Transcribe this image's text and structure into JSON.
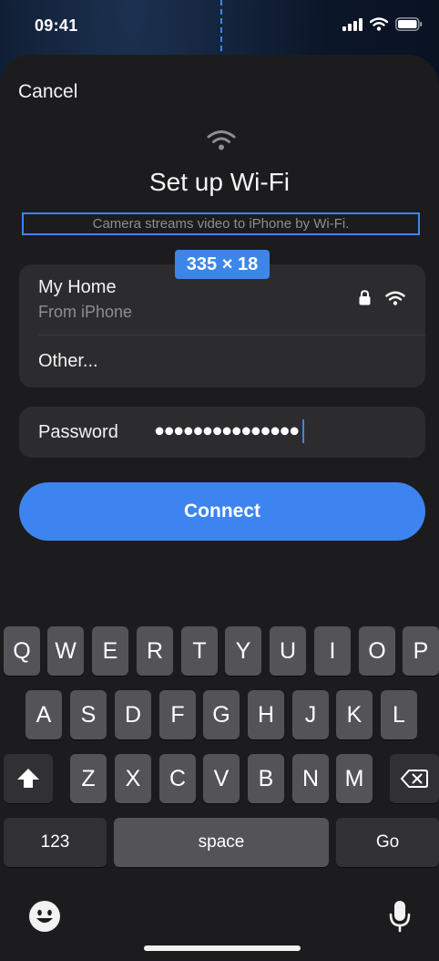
{
  "status_bar": {
    "time": "09:41"
  },
  "header": {
    "cancel_label": "Cancel",
    "title": "Set up Wi-Fi",
    "subtitle": "Camera streams video to iPhone by Wi-Fi.",
    "measure_badge": "335 × 18"
  },
  "network": {
    "name": "My Home",
    "source": "From iPhone",
    "other_label": "Other..."
  },
  "password": {
    "label": "Password",
    "masked_value": "●●●●●●●●●●●●●●●"
  },
  "connect_label": "Connect",
  "keyboard": {
    "row1": [
      "Q",
      "W",
      "E",
      "R",
      "T",
      "Y",
      "U",
      "I",
      "O",
      "P"
    ],
    "row2": [
      "A",
      "S",
      "D",
      "F",
      "G",
      "H",
      "J",
      "K",
      "L"
    ],
    "row3": [
      "Z",
      "X",
      "C",
      "V",
      "B",
      "N",
      "M"
    ],
    "numbers_label": "123",
    "space_label": "space",
    "go_label": "Go"
  },
  "colors": {
    "accent": "#3d86e8",
    "button": "#3d84f0",
    "sheet": "#1c1c1e",
    "field": "#2c2c2e",
    "key": "#545458",
    "key_dark": "#313134"
  },
  "icons": [
    "signal-icon",
    "wifi-icon",
    "battery-icon",
    "lock-icon",
    "shift-icon",
    "backspace-icon",
    "emoji-icon",
    "microphone-icon"
  ]
}
